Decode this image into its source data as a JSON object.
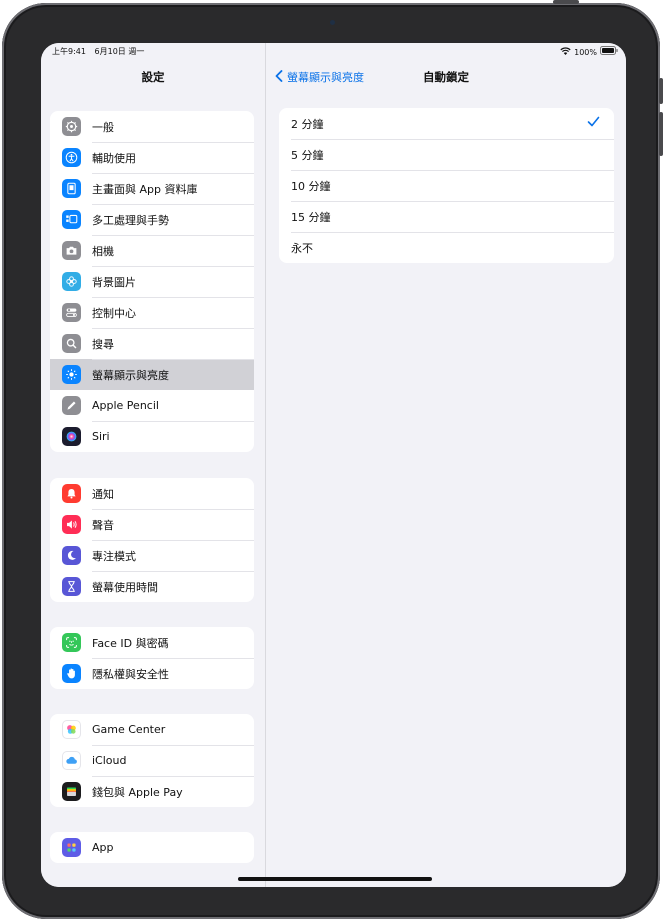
{
  "status_bar": {
    "time": "上午9:41",
    "date": "6月10日 週一",
    "battery": "100%"
  },
  "sidebar": {
    "title": "設定",
    "groups": [
      {
        "items": [
          {
            "label": "一般",
            "icon": "gear-icon",
            "color": "#8e8e93"
          },
          {
            "label": "輔助使用",
            "icon": "accessibility-icon",
            "color": "#0a84ff"
          },
          {
            "label": "主畫面與 App 資料庫",
            "icon": "home-screen-icon",
            "color": "#0a84ff"
          },
          {
            "label": "多工處理與手勢",
            "icon": "multitasking-icon",
            "color": "#0a84ff"
          },
          {
            "label": "相機",
            "icon": "camera-icon",
            "color": "#8e8e93"
          },
          {
            "label": "背景圖片",
            "icon": "wallpaper-flower-icon",
            "color": "#32ade6"
          },
          {
            "label": "控制中心",
            "icon": "toggles-icon",
            "color": "#8e8e93"
          },
          {
            "label": "搜尋",
            "icon": "search-icon",
            "color": "#8e8e93"
          },
          {
            "label": "螢幕顯示與亮度",
            "icon": "sun-icon",
            "color": "#0a84ff",
            "selected": true
          },
          {
            "label": "Apple Pencil",
            "icon": "pencil-icon",
            "color": "#8e8e93"
          },
          {
            "label": "Siri",
            "icon": "siri-icon",
            "color": "#1c1c2e"
          }
        ]
      },
      {
        "items": [
          {
            "label": "通知",
            "icon": "bell-icon",
            "color": "#ff3b30"
          },
          {
            "label": "聲音",
            "icon": "speaker-icon",
            "color": "#ff2d55"
          },
          {
            "label": "專注模式",
            "icon": "moon-icon",
            "color": "#5856d6"
          },
          {
            "label": "螢幕使用時間",
            "icon": "hourglass-icon",
            "color": "#5856d6"
          }
        ]
      },
      {
        "items": [
          {
            "label": "Face ID 與密碼",
            "icon": "faceid-icon",
            "color": "#34c759"
          },
          {
            "label": "隱私權與安全性",
            "icon": "hand-icon",
            "color": "#0a84ff"
          }
        ]
      },
      {
        "items": [
          {
            "label": "Game Center",
            "icon": "game-center-icon",
            "color": "#ffffff"
          },
          {
            "label": "iCloud",
            "icon": "cloud-icon",
            "color": "#ffffff"
          },
          {
            "label": "錢包與 Apple Pay",
            "icon": "wallet-icon",
            "color": "#1c1c1e"
          }
        ]
      },
      {
        "items": [
          {
            "label": "App",
            "icon": "apps-grid-icon",
            "color": "#5e5ce6"
          }
        ]
      }
    ]
  },
  "detail": {
    "back_label": "螢幕顯示與亮度",
    "title": "自動鎖定",
    "options": [
      {
        "label": "2 分鐘",
        "checked": true
      },
      {
        "label": "5 分鐘",
        "checked": false
      },
      {
        "label": "10 分鐘",
        "checked": false
      },
      {
        "label": "15 分鐘",
        "checked": false
      },
      {
        "label": "永不",
        "checked": false
      }
    ]
  },
  "colors": {
    "accent": "#0a72e8",
    "background": "#f2f2f7",
    "selected_row": "#d1d1d6"
  }
}
